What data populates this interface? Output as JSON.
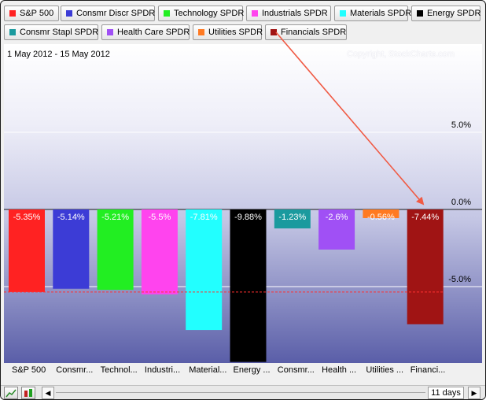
{
  "legend": [
    {
      "label": "S&P 500",
      "color": "#ff2222"
    },
    {
      "label": "Consmr Discr SPDR",
      "color": "#3c3cd6"
    },
    {
      "label": "Technology SPDR",
      "color": "#22ee22"
    },
    {
      "label": "Industrials SPDR",
      "color": "#ff44ee"
    },
    {
      "label": "Materials SPDR",
      "color": "#22ffff"
    },
    {
      "label": "Energy SPDR",
      "color": "#000000"
    },
    {
      "label": "Consmr Stapl SPDR",
      "color": "#1a9a9e"
    },
    {
      "label": "Health Care SPDR",
      "color": "#a050f5"
    },
    {
      "label": "Utilities SPDR",
      "color": "#ff7a22"
    },
    {
      "label": "Financials SPDR",
      "color": "#a01414"
    }
  ],
  "header": {
    "date_range": "1 May 2012 - 15 May 2012",
    "copyright": "Copyright, StockCharts.com"
  },
  "chart_data": {
    "type": "bar",
    "categories": [
      "S&P 500",
      "Consmr...",
      "Technol...",
      "Industri...",
      "Material...",
      "Energy ...",
      "Consmr...",
      "Health ...",
      "Utilities ...",
      "Financi..."
    ],
    "values": [
      -5.35,
      -5.14,
      -5.21,
      -5.5,
      -7.81,
      -9.88,
      -1.23,
      -2.6,
      -0.56,
      -7.44
    ],
    "value_labels": [
      "-5.35%",
      "-5.14%",
      "-5.21%",
      "-5.5%",
      "-7.81%",
      "-9.88%",
      "-1.23%",
      "-2.6%",
      "-0.56%",
      "-7.44%"
    ],
    "colors": [
      "#ff2222",
      "#3c3cd6",
      "#22ee22",
      "#ff44ee",
      "#22ffff",
      "#000000",
      "#1a9a9e",
      "#a050f5",
      "#ff7a22",
      "#a01414"
    ],
    "yticks": [
      "5.0%",
      "0.0%",
      "-5.0%"
    ],
    "tick_values": [
      5,
      0,
      -5
    ],
    "reference_line": -5.35,
    "ylim": [
      -10,
      10
    ],
    "grid": true
  },
  "annotation": {
    "type": "arrow",
    "color": "#f05a44",
    "from_series": "Financials SPDR",
    "to_series": "Financials SPDR"
  },
  "bottom": {
    "period": "11 days",
    "scroll_left": "◀",
    "scroll_right": "▶"
  }
}
